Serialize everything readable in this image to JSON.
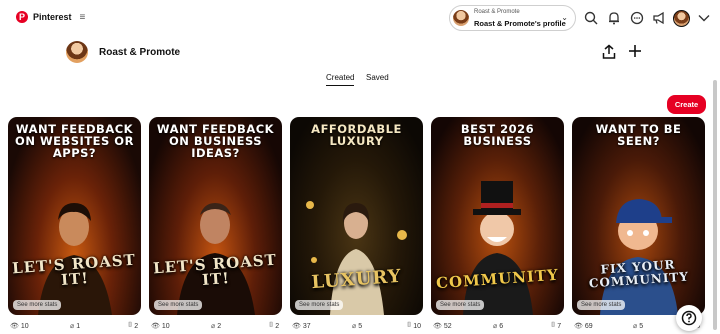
{
  "header": {
    "logo_text": "Pinterest",
    "account_switch": {
      "line1": "Roast & Promote",
      "line2": "Roast & Promote's profile"
    }
  },
  "profile": {
    "name": "Roast & Promote"
  },
  "tabs": [
    {
      "label": "Created"
    },
    {
      "label": "Saved"
    }
  ],
  "create_button": "Create",
  "pins": [
    {
      "headline": "WANT FEEDBACK ON WEBSITES OR APPS?",
      "overlay_text": "LET'S ROAST IT!",
      "chip": "See more stats",
      "views": "10",
      "clicks": "1",
      "saves": "2",
      "palette": "fire"
    },
    {
      "headline": "WANT FEEDBACK ON BUSINESS IDEAS?",
      "overlay_text": "LET'S ROAST IT!",
      "chip": "See more stats",
      "views": "10",
      "clicks": "2",
      "saves": "2",
      "palette": "fire"
    },
    {
      "headline": "AFFORDABLE LUXURY",
      "overlay_text": "LUXURY",
      "chip": "See more stats",
      "views": "37",
      "clicks": "5",
      "saves": "10",
      "palette": "gold"
    },
    {
      "headline": "BEST 2026 BUSINESS",
      "overlay_text": "COMMUNITY",
      "chip": "See more stats",
      "views": "52",
      "clicks": "6",
      "saves": "7",
      "palette": "fire"
    },
    {
      "headline": "WANT TO BE SEEN?",
      "overlay_text": "FIX YOUR COMMUNITY",
      "chip": "See more stats",
      "views": "69",
      "clicks": "5",
      "saves": "5",
      "palette": "fire"
    }
  ]
}
